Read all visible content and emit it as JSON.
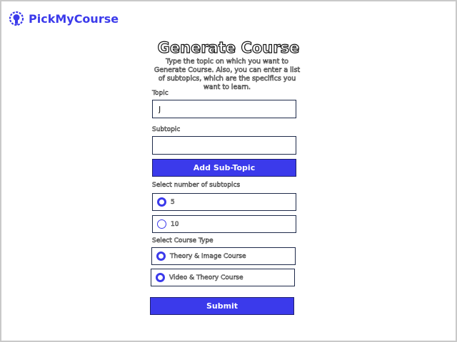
{
  "brand": {
    "name": "PickMyCourse",
    "icon": "brain-bulb-icon",
    "color": "#3b3aeb"
  },
  "page": {
    "title": "Generate Course",
    "description": "Type the topic on which you want to Generate Course. Also, you can enter a list of subtopics, which are the specifics you want to learn."
  },
  "form": {
    "topic_label": "Topic",
    "topic_value": "J",
    "subtopic_label": "Subtopic",
    "subtopic_value": "",
    "add_subtopic_label": "Add Sub-Topic",
    "num_subtopics_label": "Select number of subtopics",
    "num_options": [
      {
        "label": "5",
        "selected": true
      },
      {
        "label": "10",
        "selected": false
      }
    ],
    "course_type_label": "Select Course Type",
    "course_types": [
      {
        "label": "Theory & Image Course",
        "selected": true
      },
      {
        "label": "Video & Theory Course",
        "selected": true
      }
    ],
    "submit_label": "Submit"
  },
  "colors": {
    "accent": "#3b3aeb",
    "border": "#1e2a4a"
  }
}
